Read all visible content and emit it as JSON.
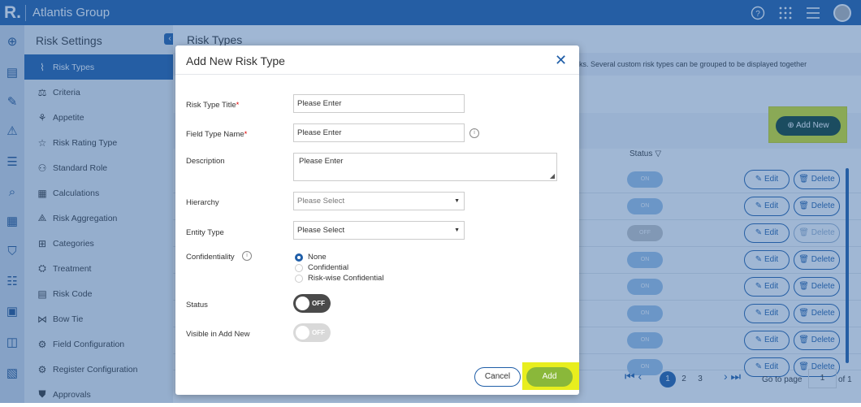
{
  "app": {
    "logo": "R.",
    "brand": "Atlantis Group"
  },
  "topbar": {
    "help_icon": "help-circle-icon",
    "apps_icon": "grid-icon",
    "menu_icon": "hamburger-icon"
  },
  "sidebar": {
    "title": "Risk Settings",
    "items": [
      {
        "label": "Risk Types",
        "icon": "⌇"
      },
      {
        "label": "Criteria",
        "icon": "⚖"
      },
      {
        "label": "Appetite",
        "icon": "⚘"
      },
      {
        "label": "Risk Rating Type",
        "icon": "☆"
      },
      {
        "label": "Standard Role",
        "icon": "⚇"
      },
      {
        "label": "Calculations",
        "icon": "▦"
      },
      {
        "label": "Risk Aggregation",
        "icon": "⟁"
      },
      {
        "label": "Categories",
        "icon": "⊞"
      },
      {
        "label": "Treatment",
        "icon": "⛭"
      },
      {
        "label": "Risk Code",
        "icon": "▤"
      },
      {
        "label": "Bow Tie",
        "icon": "⋈"
      },
      {
        "label": "Field Configuration",
        "icon": "⚙"
      },
      {
        "label": "Register Configuration",
        "icon": "⚙"
      },
      {
        "label": "Approvals",
        "icon": "⛊"
      }
    ]
  },
  "main": {
    "title": "Risk Types",
    "description": "ks. Several custom risk types can be grouped to be displayed together",
    "add_new_label": "Add New",
    "status_header": "Status",
    "rows": [
      {
        "toggle": "ON",
        "delete_enabled": true
      },
      {
        "toggle": "ON",
        "delete_enabled": true
      },
      {
        "toggle": "OFF",
        "delete_enabled": false
      },
      {
        "toggle": "ON",
        "delete_enabled": true
      },
      {
        "toggle": "ON",
        "delete_enabled": true
      },
      {
        "toggle": "ON",
        "delete_enabled": true
      },
      {
        "toggle": "ON",
        "delete_enabled": true
      },
      {
        "toggle": "ON",
        "delete_enabled": true
      }
    ],
    "edit_label": "Edit",
    "delete_label": "Delete",
    "pager": {
      "pages": [
        "1",
        "2",
        "3"
      ],
      "current": "1",
      "goto_label": "Go to page",
      "goto_value": "1",
      "of_label": "of 1"
    }
  },
  "modal": {
    "title": "Add New Risk Type",
    "fields": {
      "title_label": "Risk Type Title",
      "title_placeholder": "Please Enter",
      "field_type_label": "Field Type Name",
      "field_type_placeholder": "Please Enter",
      "description_label": "Description",
      "description_placeholder": "Please Enter",
      "hierarchy_label": "Hierarchy",
      "hierarchy_value": "Please Select",
      "entity_type_label": "Entity Type",
      "entity_type_value": "Please Select",
      "confidentiality_label": "Confidentiality",
      "confidentiality_options": [
        "None",
        "Confidential",
        "Risk-wise Confidential"
      ],
      "confidentiality_selected": "None",
      "status_label": "Status",
      "status_toggle": "OFF",
      "visible_label": "Visible in Add New",
      "visible_toggle": "OFF"
    },
    "cancel_label": "Cancel",
    "add_label": "Add",
    "required_mark": "*"
  },
  "colors": {
    "primary": "#1f5ea8",
    "highlight": "#e8ee1e",
    "add_button": "#8ab83a",
    "add_new_button": "#0d3d2c"
  }
}
